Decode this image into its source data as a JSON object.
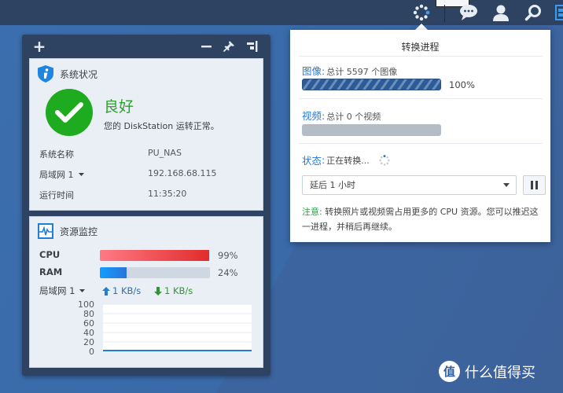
{
  "taskbar": {
    "icons": [
      "media-indexing-icon",
      "notifications-icon",
      "user-icon",
      "search-icon",
      "widgets-icon"
    ],
    "accent_color": "#3a9cf0"
  },
  "widget_panel": {
    "toolbar": {
      "add_label": "+",
      "minimize_label": "—",
      "pin_icon": "pin-icon",
      "layout_icon": "layout-icon"
    },
    "system_health": {
      "title": "系统状况",
      "status": "良好",
      "description": "您的 DiskStation 运转正常。",
      "status_color": "#1fab1f",
      "rows": [
        {
          "label": "系统名称",
          "value": "PU_NAS"
        },
        {
          "label": "局域网 1",
          "value": "192.168.68.115",
          "has_dropdown": true
        },
        {
          "label": "运行时间",
          "value": "11:35:20"
        }
      ]
    },
    "resource_monitor": {
      "title": "资源监控",
      "cpu": {
        "label": "CPU",
        "percent_text": "99%",
        "value": 99
      },
      "ram": {
        "label": "RAM",
        "percent_text": "24%",
        "value": 24
      },
      "network": {
        "label": "局域网 1",
        "upload": "1 KB/s",
        "download": "1 KB/s"
      },
      "chart": {
        "y_ticks": [
          "100",
          "80",
          "60",
          "40",
          "20",
          "0"
        ],
        "ylim": [
          0,
          100
        ]
      }
    }
  },
  "popup": {
    "title": "转换进程",
    "images": {
      "key": "图像",
      "colon": ":",
      "detail": "总计 5597 个图像",
      "progress_text": "100%",
      "progress": 100
    },
    "videos": {
      "key": "视频",
      "colon": ":",
      "detail": "总计 0 个视频",
      "progress": 0
    },
    "status": {
      "key": "状态",
      "colon": ":",
      "detail": "正在转换..."
    },
    "delay_select": {
      "selected": "延后 1 小时"
    },
    "pause_button": "pause-icon",
    "note": {
      "key": "注意",
      "colon": ":",
      "text": " 转换照片或视频需占用更多的 CPU 资源。您可以推迟这一进程，并稍后再继续。"
    }
  },
  "watermark": {
    "badge": "值",
    "text": "什么值得买"
  }
}
